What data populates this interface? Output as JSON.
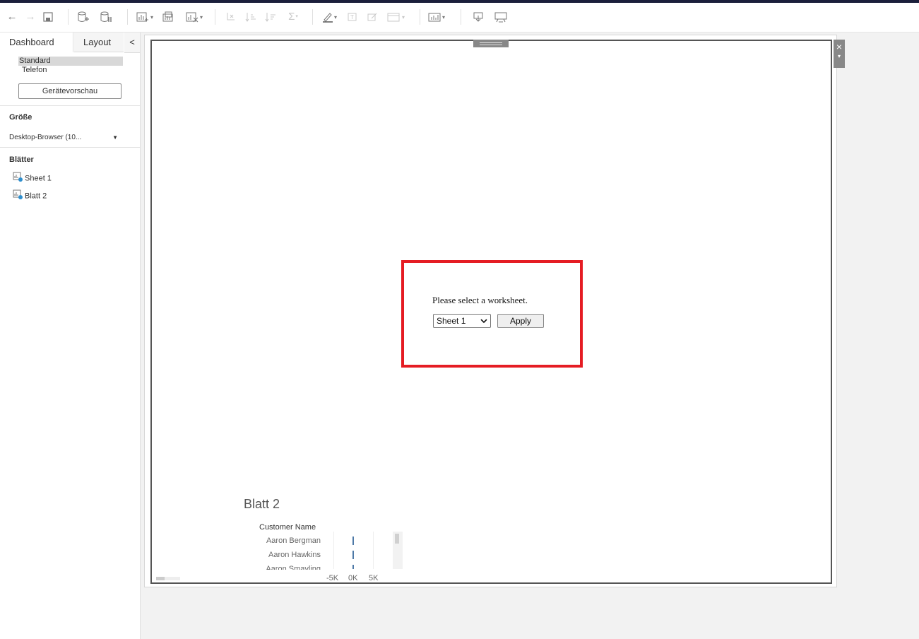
{
  "toolbar": {
    "buttons": [
      {
        "name": "undo-icon",
        "glyph": "←"
      },
      {
        "name": "redo-icon",
        "glyph": "→"
      },
      {
        "name": "save-icon",
        "glyph": ""
      },
      {
        "name": "new-datasource-icon",
        "glyph": ""
      },
      {
        "name": "pause-updates-icon",
        "glyph": ""
      },
      {
        "name": "new-worksheet-icon",
        "glyph": ""
      },
      {
        "name": "duplicate-sheet-icon",
        "glyph": ""
      },
      {
        "name": "clear-sheet-icon",
        "glyph": ""
      },
      {
        "name": "swap-axes-icon",
        "glyph": ""
      },
      {
        "name": "sort-ascending-icon",
        "glyph": ""
      },
      {
        "name": "sort-descending-icon",
        "glyph": ""
      },
      {
        "name": "totals-icon",
        "glyph": "Σ"
      },
      {
        "name": "highlight-icon",
        "glyph": ""
      },
      {
        "name": "labels-icon",
        "glyph": ""
      },
      {
        "name": "annotate-icon",
        "glyph": ""
      },
      {
        "name": "fit-icon",
        "glyph": ""
      },
      {
        "name": "show-me-icon",
        "glyph": ""
      },
      {
        "name": "download-icon",
        "glyph": ""
      },
      {
        "name": "presentation-icon",
        "glyph": ""
      }
    ]
  },
  "sidebar": {
    "tabs": {
      "dashboard": "Dashboard",
      "layout": "Layout",
      "collapse": "<"
    },
    "devices": {
      "standard": "Standard",
      "phone": "Telefon"
    },
    "device_preview_button": "Gerätevorschau",
    "size_title": "Größe",
    "size_value": "Desktop-Browser (10...",
    "size_arrow": "▼",
    "sheets_title": "Blätter",
    "sheets": [
      "Sheet 1",
      "Blatt 2"
    ]
  },
  "extension": {
    "prompt": "Please select a worksheet.",
    "selected_sheet": "Sheet 1",
    "apply_label": "Apply",
    "highlight_color": "#e51c23"
  },
  "embedded_sheet": {
    "title": "Blatt 2",
    "column_header": "Customer Name",
    "rows": [
      "Aaron Bergman",
      "Aaron Hawkins",
      "Aaron Smayling"
    ],
    "axis_ticks": [
      "-5K",
      "0K",
      "5K"
    ],
    "bar_color": "#4e79a7"
  },
  "frame_controls": {
    "close": "×",
    "more": "▾"
  }
}
